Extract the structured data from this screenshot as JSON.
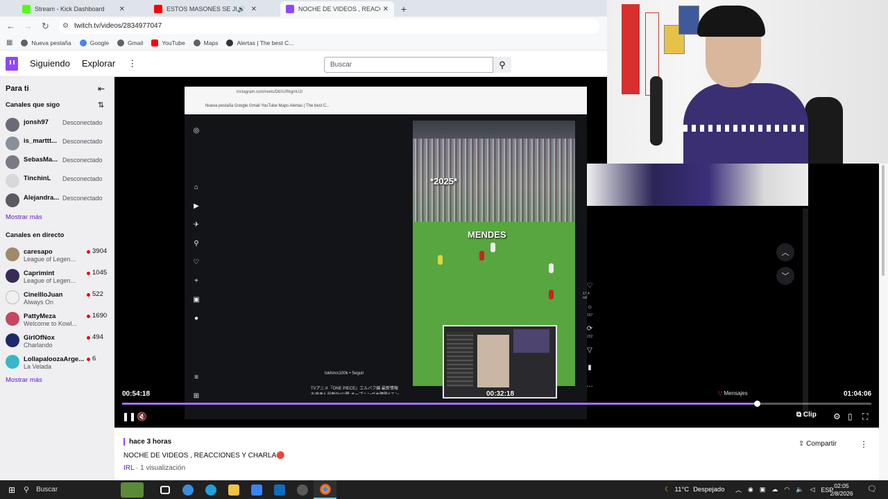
{
  "browser": {
    "tabs": [
      {
        "title": "Stream - Kick Dashboard",
        "favicon_color": "#53fc18",
        "active": false,
        "audio": false
      },
      {
        "title": "ESTOS MASONES SE JUNTARON",
        "favicon_color": "#ff0000",
        "active": false,
        "audio": true
      },
      {
        "title": "NOCHE DE VIDEOS , REACCION",
        "favicon_color": "#9146ff",
        "active": true,
        "audio": false
      }
    ],
    "new_tab_label": "+",
    "url": "twitch.tv/videos/2834977047",
    "bookmarks": [
      {
        "label": "Nueva pestaña",
        "color": "#5f6368"
      },
      {
        "label": "Google",
        "color": "#4285f4"
      },
      {
        "label": "Gmail",
        "color": "#5f6368"
      },
      {
        "label": "YouTube",
        "color": "#ff0000"
      },
      {
        "label": "Maps",
        "color": "#5f6368"
      },
      {
        "label": "Alertas | The best C...",
        "color": "#333333"
      }
    ]
  },
  "twitch_nav": {
    "following": "Siguiendo",
    "browse": "Explorar",
    "search_placeholder": "Buscar",
    "accent": "#9146ff"
  },
  "sidebar": {
    "title": "Para ti",
    "followed_header": "Canales que sigo",
    "followed": [
      {
        "name": "jonsh97",
        "status": "Desconectado",
        "avatar_color": "#6b6b75"
      },
      {
        "name": "is_marttt...",
        "status": "Desconectado",
        "avatar_color": "#8a8f99"
      },
      {
        "name": "SebasMa...",
        "status": "Desconectado",
        "avatar_color": "#7a7a82"
      },
      {
        "name": "TinchinL",
        "status": "Desconectado",
        "avatar_color": "#d8d8dc"
      },
      {
        "name": "Alejandra...",
        "status": "Desconectado",
        "avatar_color": "#5a5a62"
      }
    ],
    "show_more": "Mostrar más",
    "live_header": "Canales en directo",
    "live": [
      {
        "name": "caresapo",
        "game": "League of Legen...",
        "viewers": "3904",
        "avatar_color": "#a08a6a"
      },
      {
        "name": "Caprimint",
        "game": "League of Legen...",
        "viewers": "1045",
        "avatar_color": "#3a2a5a"
      },
      {
        "name": "CinellloJuan",
        "game": "Always On",
        "viewers": "522",
        "avatar_color": "#f1f1f1"
      },
      {
        "name": "PattyMeza",
        "game": "Welcome to Kowl...",
        "viewers": "1690",
        "avatar_color": "#c5485e"
      },
      {
        "name": "GirlOfNox",
        "game": "Charlando",
        "viewers": "494",
        "avatar_color": "#1c2a6a"
      },
      {
        "name": "LollapaloozaArge...",
        "game": "La Velada",
        "viewers": "6",
        "avatar_color": "#36b7c9"
      }
    ],
    "show_more_live": "Mostrar más"
  },
  "player": {
    "inner_url": "instagram.com/reels/DbXcRkgmU2/",
    "inner_bookmarks": "Nueva pestaña   Google   Gmail   YouTube   Maps   Alertas | The best C...",
    "reel_text_year": "*2025*",
    "reel_text_name": "MENDES",
    "reel_likes": "17,4 mil",
    "reel_comments": "157",
    "reel_shares": "222",
    "reel_user": "tokhirvc100k • Seguir",
    "reel_caption": "TVアニメ『ONE PIECE』エルバフ編 最新情報を発表& 最新PV公開 オープニング主題歌&エンディング主題歌",
    "messages_label": "Mensajes",
    "time_current": "00:54:18",
    "time_hover": "00:32:18",
    "time_total": "01:04:06",
    "progress": 0.847,
    "clip_label": "Clip"
  },
  "video_info": {
    "ago": "hace 3 horas",
    "title": "NOCHE DE VIDEOS , REACCIONES Y CHARLA🔴",
    "category": "IRL",
    "views": " · 1 visualización",
    "share": "Compartir"
  },
  "taskbar": {
    "search": "Buscar",
    "apps": [
      {
        "name": "task-view",
        "color": "#ffffff"
      },
      {
        "name": "copilot",
        "color": "#3a8dde"
      },
      {
        "name": "edge",
        "color": "#1fa0d8"
      },
      {
        "name": "file-explorer",
        "color": "#f3c244"
      },
      {
        "name": "store",
        "color": "#3b82f6"
      },
      {
        "name": "outlook",
        "color": "#0f6cbd"
      },
      {
        "name": "obs",
        "color": "#5a5a5a"
      },
      {
        "name": "chrome",
        "color": "#e6a817"
      }
    ],
    "temperature": "11°C",
    "weather": "Despejado",
    "lang": "ESP",
    "time": "02:05",
    "date": "2/8/2026"
  }
}
